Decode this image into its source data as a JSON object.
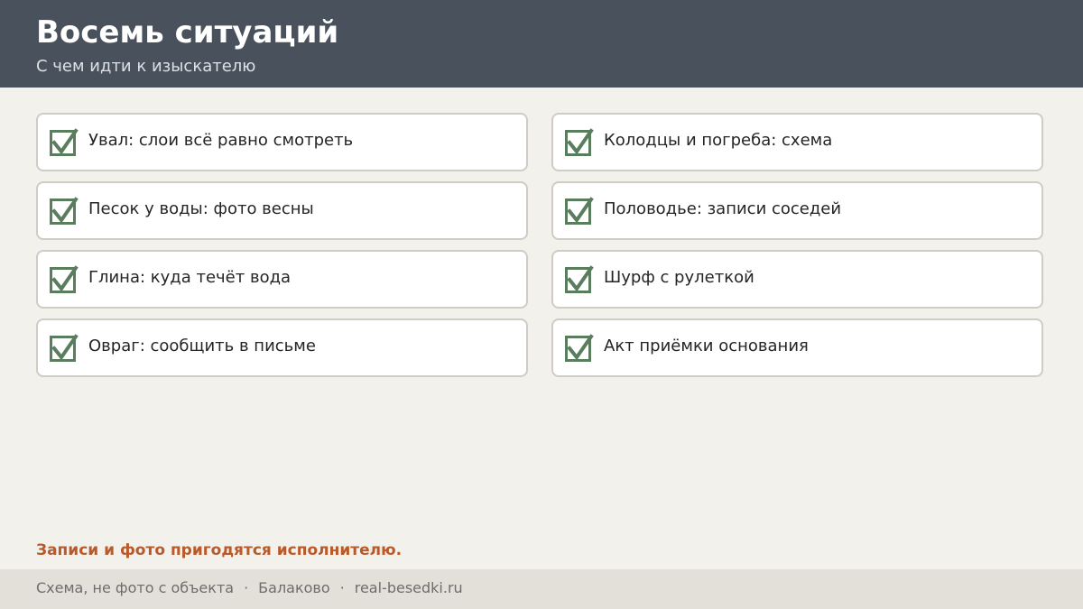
{
  "header": {
    "title": "Восемь ситуаций",
    "subtitle": "С чем идти к изыскателю"
  },
  "checklist": {
    "items": [
      {
        "label": "Увал: слои всё равно смотреть",
        "checked": true
      },
      {
        "label": "Колодцы и погреба: схема",
        "checked": true
      },
      {
        "label": "Песок у воды: фото весны",
        "checked": true
      },
      {
        "label": "Половодье: записи соседей",
        "checked": true
      },
      {
        "label": "Глина: куда течёт вода",
        "checked": true
      },
      {
        "label": "Шурф с рулеткой",
        "checked": true
      },
      {
        "label": "Овраг: сообщить в письме",
        "checked": true
      },
      {
        "label": "Акт приёмки основания",
        "checked": true
      }
    ]
  },
  "note": "Записи и фото пригодятся исполнителю.",
  "footer": {
    "caption": "Схема, не фото с объекта",
    "separator": "·",
    "city": "Балаково",
    "site": "real-besedki.ru"
  },
  "colors": {
    "header_bg": "#48515c",
    "page_bg": "#f3f1ec",
    "check_green": "#5a7d5e",
    "accent_orange": "#b85a2a",
    "footer_bg": "#e3e0da"
  },
  "icons": {
    "check": "checkmark-icon"
  }
}
